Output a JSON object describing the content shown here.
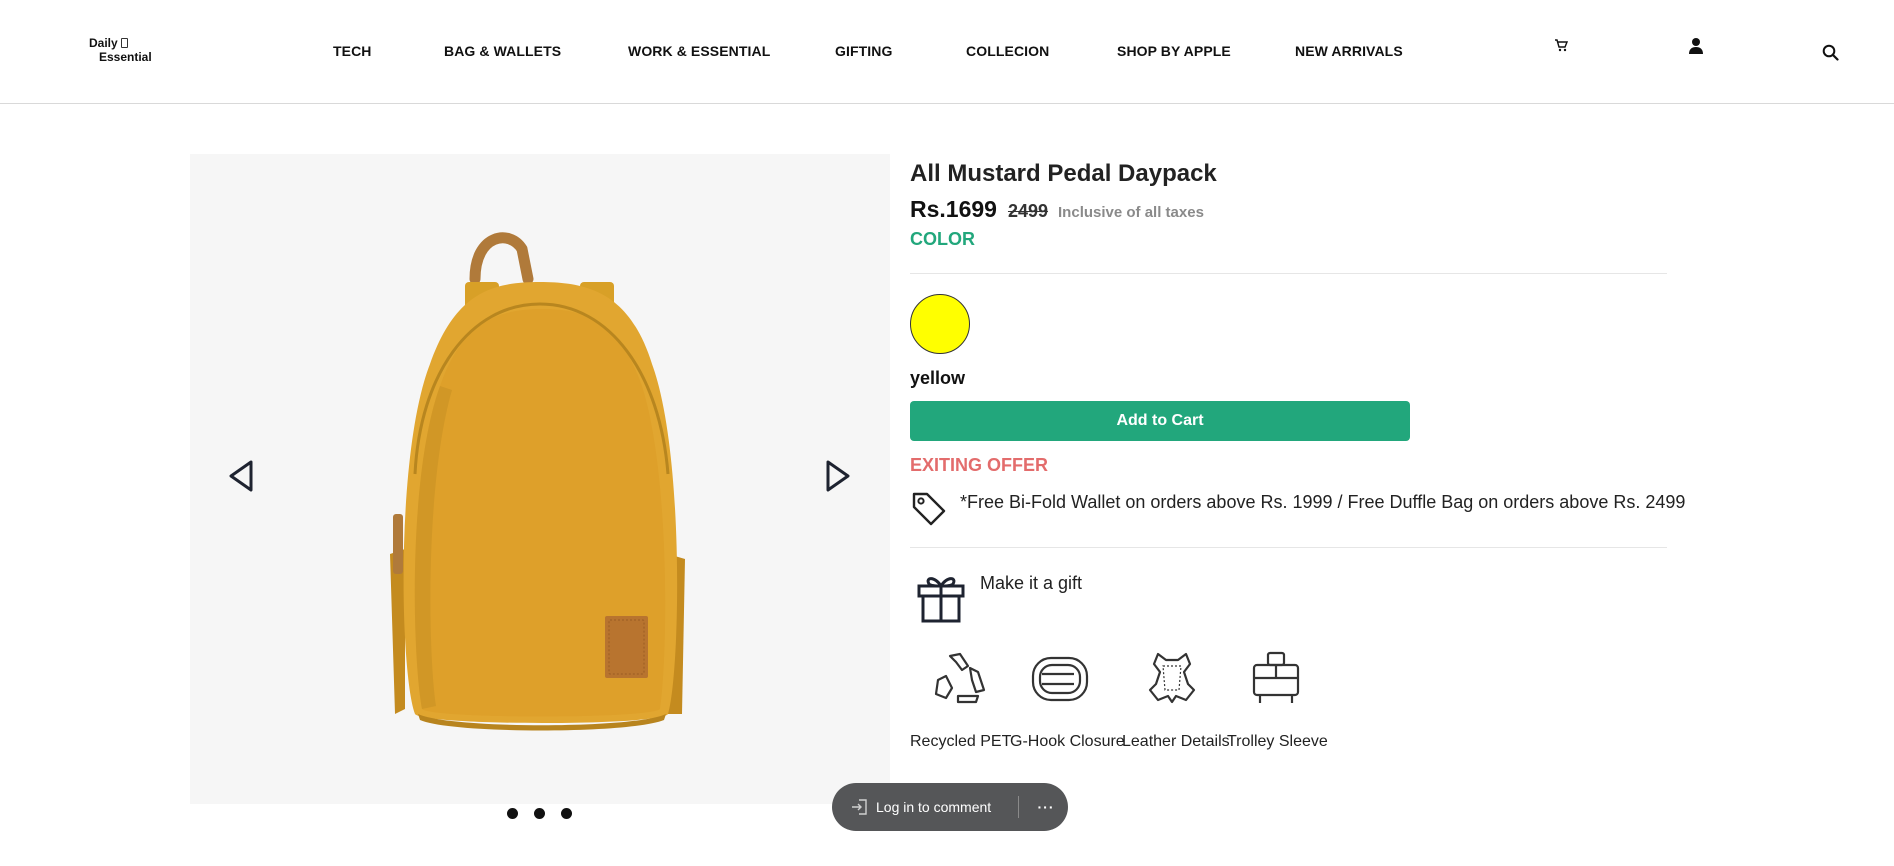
{
  "header": {
    "logo_line1": "Daily",
    "logo_line2": "Essential",
    "nav": [
      {
        "label": "TECH"
      },
      {
        "label": "BAG & WALLETS"
      },
      {
        "label": "WORK & ESSENTIAL"
      },
      {
        "label": "GIFTING"
      },
      {
        "label": "COLLECION"
      },
      {
        "label": "SHOP BY APPLE"
      },
      {
        "label": "NEW ARRIVALS"
      }
    ],
    "icons": [
      "cart-icon",
      "user-icon",
      "search-icon"
    ]
  },
  "gallery": {
    "image": "mustard-backpack-image",
    "prev_icon": "triangle-left-icon",
    "next_icon": "triangle-right-icon",
    "dots_count": 3,
    "background": "#f6f6f6"
  },
  "product": {
    "title": "All Mustard Pedal Daypack",
    "price": "Rs.1699",
    "old_price": "2499",
    "tax_note": "Inclusive of all taxes",
    "color_label": "COLOR",
    "selected_color_name": "yellow",
    "selected_color_hex": "#ffff00",
    "add_to_cart": "Add to Cart",
    "offer_title": "EXITING OFFER",
    "offer_text": "*Free Bi-Fold Wallet on orders above Rs. 1999 / Free Duffle Bag on orders above Rs. 2499",
    "gift_text": "Make it a gift",
    "features": [
      {
        "label": "Recycled PET",
        "icon": "recycle-icon"
      },
      {
        "label": "G-Hook Closure",
        "icon": "g-hook-icon"
      },
      {
        "label": "Leather Details",
        "icon": "leather-icon"
      },
      {
        "label": "Trolley Sleeve",
        "icon": "trolley-icon"
      }
    ]
  },
  "comment_pill": {
    "login_label": "Log in to comment",
    "more_label": "···"
  },
  "colors": {
    "accent_green": "#22a77c",
    "offer_red": "#e36c6c",
    "pill_bg": "#555658"
  }
}
